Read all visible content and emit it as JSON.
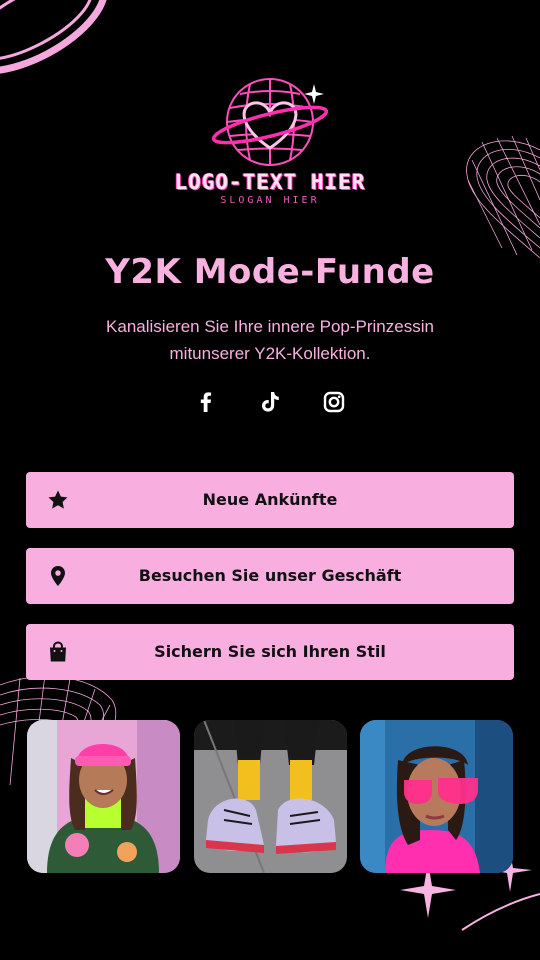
{
  "brand": {
    "logo_text": "LOGO-TEXT HIER",
    "slogan": "SLOGAN HIER",
    "logo_icon": "heart-disco-ball-icon"
  },
  "hero": {
    "title": "Y2K Mode-Funde",
    "subtitle_line1": "Kanalisieren Sie Ihre innere Pop-Prinzessin",
    "subtitle_line2": "mitunserer Y2K-Kollektion."
  },
  "socials": [
    {
      "icon": "facebook-icon"
    },
    {
      "icon": "tiktok-icon"
    },
    {
      "icon": "instagram-icon"
    }
  ],
  "links": [
    {
      "label": "Neue Ankünfte",
      "icon": "star-icon"
    },
    {
      "label": "Besuchen Sie unser Geschäft",
      "icon": "location-pin-icon"
    },
    {
      "label": "Sichern Sie sich Ihren Stil",
      "icon": "shopping-bag-icon"
    }
  ],
  "gallery": [
    {
      "subject": "woman in pink beanie and neon top"
    },
    {
      "subject": "patterned socks and sneakers"
    },
    {
      "subject": "woman with pink sunglasses"
    }
  ],
  "colors": {
    "background": "#000000",
    "accent_pink": "#f9aee0",
    "title_pink": "#f8b1e1",
    "button_text": "#111111"
  }
}
